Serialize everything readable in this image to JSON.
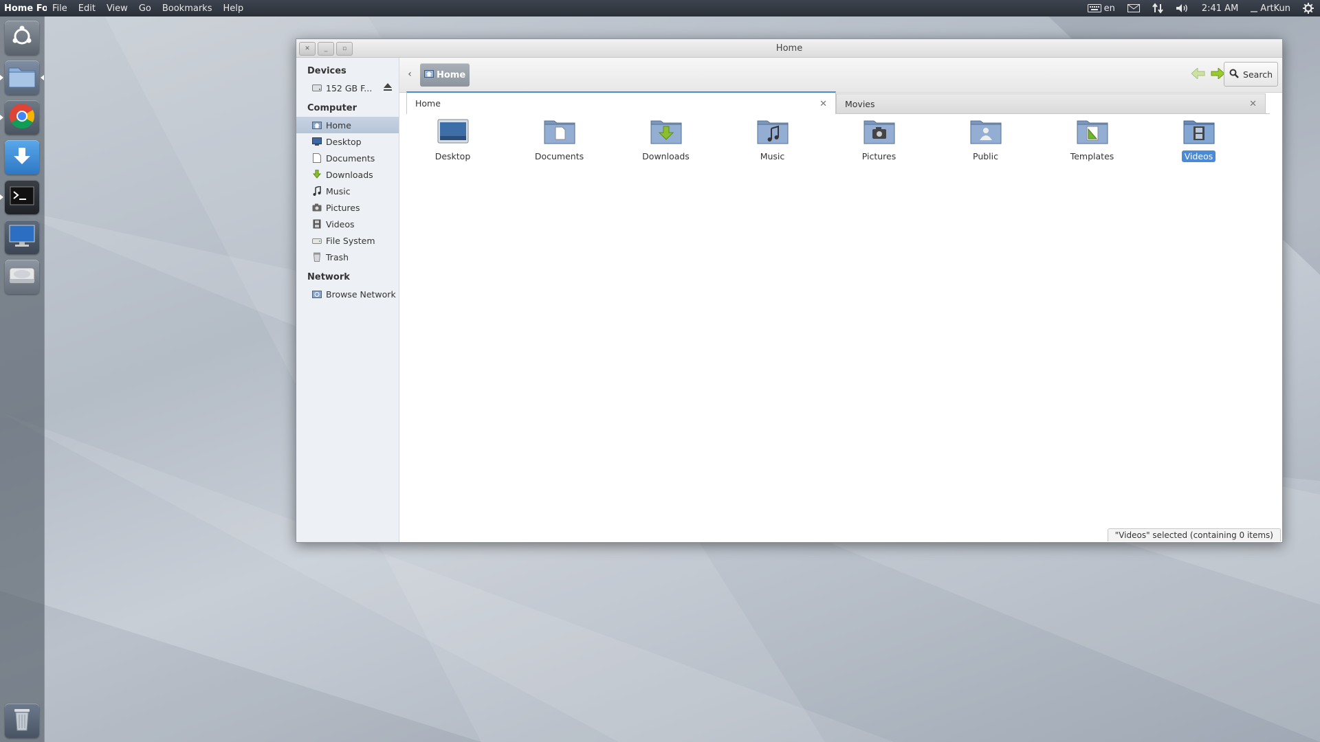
{
  "top_panel": {
    "app_title": "Home Folder",
    "menu": [
      "File",
      "Edit",
      "View",
      "Go",
      "Bookmarks",
      "Help"
    ],
    "keyboard_layout": "en",
    "clock": "2:41 AM",
    "user": "ArtKun"
  },
  "launcher": {
    "items": [
      "dash-home",
      "files",
      "chromium-browser",
      "downloader",
      "terminal",
      "desktop-display",
      "disk-drive"
    ],
    "trash": "trash"
  },
  "window": {
    "title": "Home",
    "sidebar": {
      "devices_header": "Devices",
      "device_label": "152 GB F...",
      "computer_header": "Computer",
      "computer_items": [
        {
          "label": "Home",
          "icon": "home-folder-icon"
        },
        {
          "label": "Desktop",
          "icon": "desktop-icon"
        },
        {
          "label": "Documents",
          "icon": "document-icon"
        },
        {
          "label": "Downloads",
          "icon": "download-arrow-icon"
        },
        {
          "label": "Music",
          "icon": "music-note-icon"
        },
        {
          "label": "Pictures",
          "icon": "camera-icon"
        },
        {
          "label": "Videos",
          "icon": "film-icon"
        },
        {
          "label": "File System",
          "icon": "drive-icon"
        },
        {
          "label": "Trash",
          "icon": "trash-icon"
        }
      ],
      "network_header": "Network",
      "network_items": [
        {
          "label": "Browse Network",
          "icon": "network-icon"
        }
      ]
    },
    "toolbar": {
      "breadcrumb": "Home",
      "search_label": "Search"
    },
    "tabs": [
      {
        "label": "Home",
        "active": true
      },
      {
        "label": "Movies",
        "active": false
      }
    ],
    "files": [
      {
        "label": "Desktop",
        "type": "desktop"
      },
      {
        "label": "Documents",
        "type": "documents"
      },
      {
        "label": "Downloads",
        "type": "downloads"
      },
      {
        "label": "Music",
        "type": "music"
      },
      {
        "label": "Pictures",
        "type": "pictures"
      },
      {
        "label": "Public",
        "type": "public"
      },
      {
        "label": "Templates",
        "type": "templates"
      },
      {
        "label": "Videos",
        "type": "videos",
        "selected": true
      }
    ],
    "status": "\"Videos\" selected (containing 0 items)"
  },
  "colors": {
    "selection": "#4a8ad6",
    "panel": "#2b3038",
    "sidebar": "#edf0f4"
  }
}
